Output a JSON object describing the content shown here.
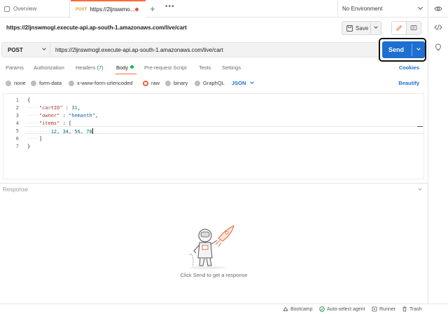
{
  "tabs": {
    "overview_label": "Overview",
    "active_method": "POST",
    "active_label": "https://2ljnswmo...",
    "more_glyph": "•••",
    "plus_glyph": "+"
  },
  "environment": {
    "label": "No Environment"
  },
  "request": {
    "title": "https://2ljnswmogl.execute-api.ap-south-1.amazonaws.com/live/cart",
    "method": "POST",
    "url": "https://2ljnswmogl.execute-api.ap-south-1.amazonaws.com/live/cart",
    "save_label": "Save",
    "send_label": "Send"
  },
  "request_tabs": {
    "params": "Params",
    "authorization": "Authorization",
    "headers": "Headers",
    "headers_count": "(7)",
    "body": "Body",
    "pre_request": "Pre-request Script",
    "tests": "Tests",
    "settings": "Settings",
    "cookies": "Cookies"
  },
  "body_types": {
    "none": "none",
    "form_data": "form-data",
    "urlencoded": "x-www-form-urlencoded",
    "raw": "raw",
    "binary": "binary",
    "graphql": "GraphQL",
    "format": "JSON",
    "beautify": "Beautify"
  },
  "editor": {
    "line_numbers": [
      "1",
      "2",
      "3",
      "4",
      "5",
      "6",
      "7"
    ],
    "l1": "{",
    "l2_key": "\"cartID\"",
    "l2_val": "31",
    "l3_key": "\"owner\"",
    "l3_val": "\"hemanth\"",
    "l4_key": "\"items\"",
    "l4_open": "[",
    "l5_vals": "12, 34, 56, 78",
    "l6": "]",
    "l7": "}"
  },
  "response": {
    "label": "Response",
    "empty_message": "Click Send to get a response"
  },
  "statusbar": {
    "bootcamp": "Bootcamp",
    "auto_select_agent": "Auto-select agent",
    "runner": "Runner",
    "trash": "Trash"
  },
  "colors": {
    "accent": "#ff6c37",
    "send_blue": "#1d6fd1",
    "link_blue": "#1d6fd1",
    "body_dot_green": "#0cbb52",
    "headers_count_green": "#0c8a3c",
    "raw_radio": "#e8643a"
  },
  "icons": {
    "overview": "overview-icon",
    "eye": "eye-icon",
    "save": "save-icon",
    "doc_edit": "pencil-icon",
    "doc_comment": "comment-icon",
    "code": "code-icon",
    "bulb": "lightbulb-icon",
    "bootcamp": "bootcamp-icon",
    "agent": "check-circle-icon",
    "runner": "runner-icon",
    "trash": "trash-icon"
  }
}
